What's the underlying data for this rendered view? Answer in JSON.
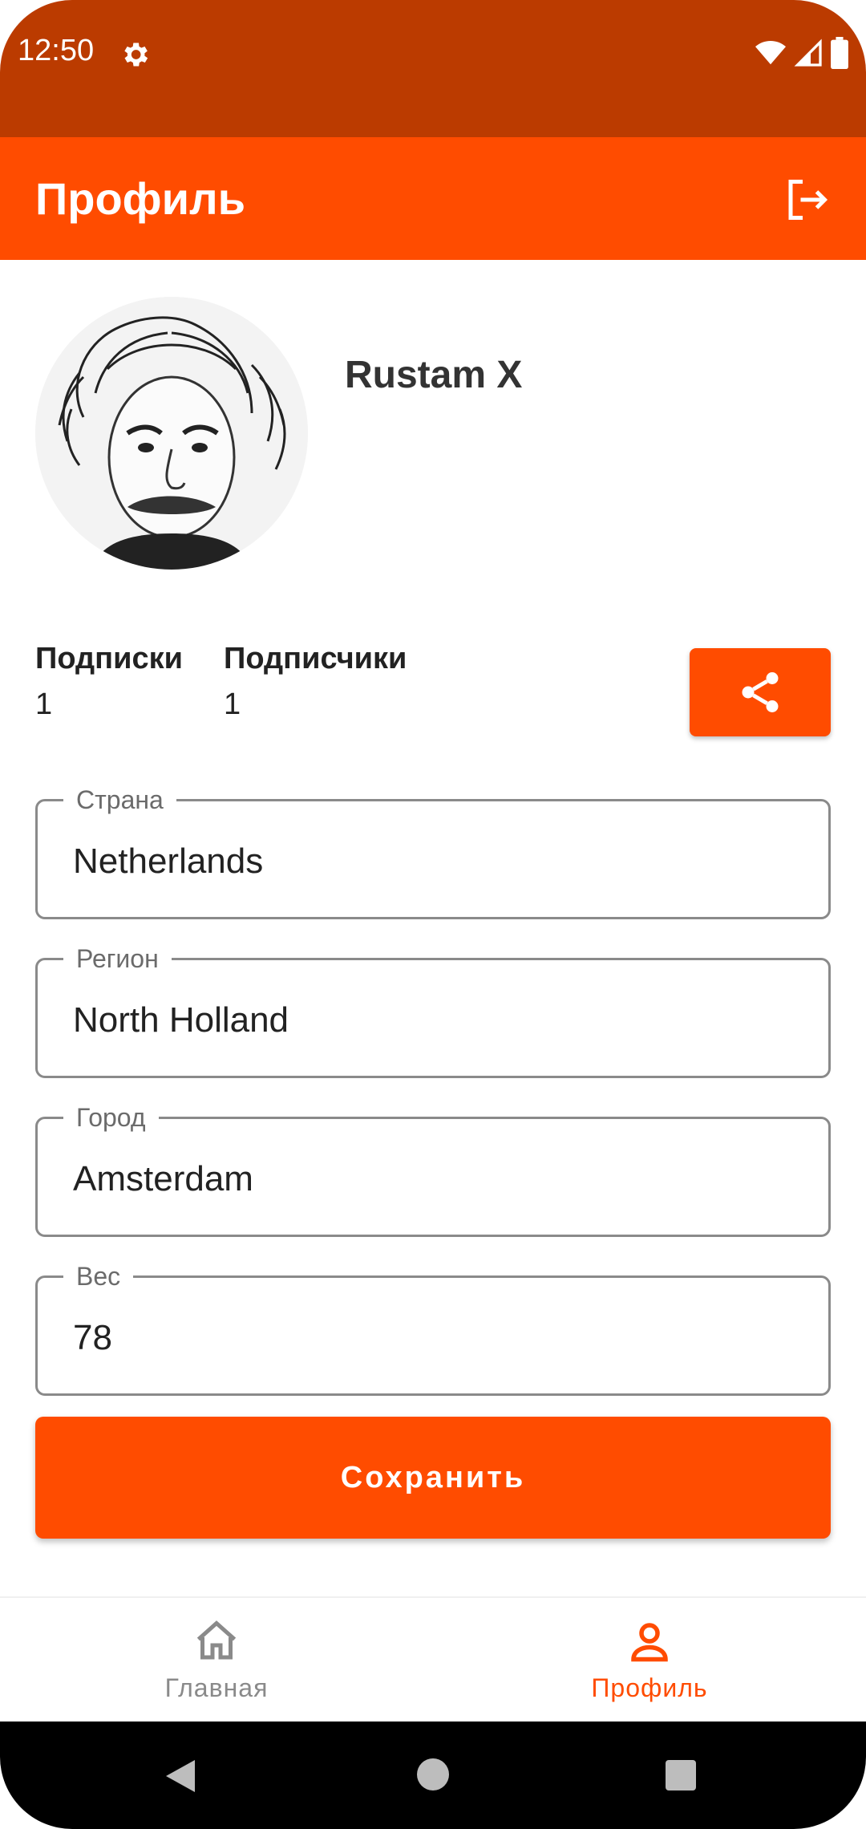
{
  "status_bar": {
    "time": "12:50",
    "icons": [
      "gear-icon",
      "wifi-icon",
      "signal-icon",
      "battery-icon"
    ]
  },
  "app_bar": {
    "title": "Профиль",
    "action_icon": "logout-icon"
  },
  "profile": {
    "name": "Rustam X",
    "avatar": "avatar-einstein"
  },
  "stats": {
    "subscriptions_label": "Подписки",
    "subscriptions_value": "1",
    "subscribers_label": "Подписчики",
    "subscribers_value": "1"
  },
  "share_button": {
    "icon": "share-icon"
  },
  "fields": {
    "country": {
      "label": "Страна",
      "value": "Netherlands"
    },
    "region": {
      "label": "Регион",
      "value": "North Holland"
    },
    "city": {
      "label": "Город",
      "value": "Amsterdam"
    },
    "weight": {
      "label": "Вес",
      "value": "78"
    }
  },
  "save_button": {
    "label": "Сохранить"
  },
  "bottom_nav": {
    "items": [
      {
        "label": "Главная",
        "icon": "home-icon",
        "active": false
      },
      {
        "label": "Профиль",
        "icon": "person-icon",
        "active": true
      }
    ]
  },
  "colors": {
    "accent": "#ff4c00",
    "status_bar": "#bb3b00",
    "inactive": "#8a8a8a"
  }
}
